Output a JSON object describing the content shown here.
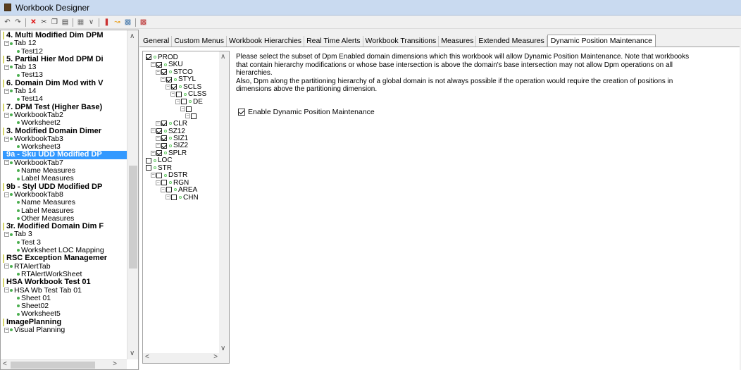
{
  "window": {
    "title": "Workbook Designer"
  },
  "toolbar": {
    "icons": [
      "undo-icon",
      "redo-icon",
      "delete-icon",
      "cut-icon",
      "copy-icon",
      "paste-icon",
      "grid-icon",
      "dropdown-icon",
      "bar-icon",
      "chart-icon",
      "table-icon",
      "graph-icon"
    ]
  },
  "tree": {
    "nodes": [
      {
        "type": "wb",
        "text": "4. Multi Modified Dim DPM"
      },
      {
        "type": "tab",
        "text": "Tab 12"
      },
      {
        "type": "sheet",
        "text": "Test12"
      },
      {
        "type": "wb",
        "text": "5. Partial Hier Mod DPM Di"
      },
      {
        "type": "tab",
        "text": "Tab 13"
      },
      {
        "type": "sheet",
        "text": "Test13"
      },
      {
        "type": "wb",
        "text": "6. Domain Dim Mod with V"
      },
      {
        "type": "tab",
        "text": "Tab 14"
      },
      {
        "type": "sheet",
        "text": "Test14"
      },
      {
        "type": "wb",
        "text": "7. DPM Test (Higher Base)"
      },
      {
        "type": "tab",
        "text": "WorkbookTab2"
      },
      {
        "type": "sheet",
        "text": "Worksheet2"
      },
      {
        "type": "wb",
        "text": "3.  Modified Domain Dimer"
      },
      {
        "type": "tab",
        "text": "WorkbookTab3"
      },
      {
        "type": "sheet",
        "text": "Worksheet3"
      },
      {
        "type": "wb",
        "text": "9a - Sku UDD Modified DP",
        "selected": true
      },
      {
        "type": "tab",
        "text": "WorkbookTab7"
      },
      {
        "type": "sheet",
        "text": "Name Measures"
      },
      {
        "type": "sheet",
        "text": "Label Measures"
      },
      {
        "type": "wb",
        "text": "9b - Styl UDD Modified DP"
      },
      {
        "type": "tab",
        "text": "WorkbookTab8"
      },
      {
        "type": "sheet",
        "text": "Name Measures"
      },
      {
        "type": "sheet",
        "text": "Label Measures"
      },
      {
        "type": "sheet",
        "text": "Other Measures"
      },
      {
        "type": "wb",
        "text": "3r. Modified Domain Dim F"
      },
      {
        "type": "tab",
        "text": "Tab 3"
      },
      {
        "type": "sheet",
        "text": "Test 3"
      },
      {
        "type": "sheet",
        "text": "Worksheet LOC Mapping"
      },
      {
        "type": "wb",
        "text": "RSC Exception Managemer"
      },
      {
        "type": "tab",
        "text": "RTAlertTab"
      },
      {
        "type": "sheet",
        "text": "RTAlertWorkSheet"
      },
      {
        "type": "wb",
        "text": "HSA Workbook Test 01"
      },
      {
        "type": "tab",
        "text": "HSA Wb Test Tab 01"
      },
      {
        "type": "sheet",
        "text": "Sheet 01"
      },
      {
        "type": "sheet",
        "text": "Sheet02"
      },
      {
        "type": "sheet",
        "text": "Worksheet5"
      },
      {
        "type": "wb",
        "text": "ImagePlanning"
      },
      {
        "type": "tab",
        "text": "Visual Planning"
      }
    ]
  },
  "tabs": [
    "General",
    "Custom Menus",
    "Workbook Hierarchies",
    "Real Time Alerts",
    "Workbook Transitions",
    "Measures",
    "Extended Measures",
    "Dynamic Position Maintenance"
  ],
  "active_tab": "Dynamic Position Maintenance",
  "dims": [
    {
      "text": "PROD",
      "checked": true,
      "level": 0
    },
    {
      "text": "SKU",
      "checked": true,
      "level": 1
    },
    {
      "text": "STCO",
      "checked": true,
      "level": 2
    },
    {
      "text": "STYL",
      "checked": true,
      "level": 3
    },
    {
      "text": "SCLS",
      "checked": true,
      "level": 4
    },
    {
      "text": "CLSS",
      "checked": false,
      "level": 5
    },
    {
      "text": "DE",
      "checked": false,
      "level": 6
    },
    {
      "text": "",
      "checked": false,
      "level": 7
    },
    {
      "text": "",
      "checked": false,
      "level": 8
    },
    {
      "text": "CLR",
      "checked": true,
      "level": 2
    },
    {
      "text": "SZ12",
      "checked": true,
      "level": 1
    },
    {
      "text": "SIZ1",
      "checked": true,
      "level": 2
    },
    {
      "text": "SIZ2",
      "checked": true,
      "level": 2
    },
    {
      "text": "SPLR",
      "checked": true,
      "level": 1
    },
    {
      "text": "LOC",
      "checked": false,
      "level": 0
    },
    {
      "text": "STR",
      "checked": false,
      "level": 0
    },
    {
      "text": "DSTR",
      "checked": false,
      "level": 1
    },
    {
      "text": "RGN",
      "checked": false,
      "level": 2
    },
    {
      "text": "AREA",
      "checked": false,
      "level": 3
    },
    {
      "text": "CHN",
      "checked": false,
      "level": 4
    }
  ],
  "description": {
    "line1": "Please select the subset of Dpm Enabled domain dimensions which this workbook will allow Dynamic Position Maintenance. Note that workbooks",
    "line2": "that contain hierarchy modifications or whose base intersection is above the domain's base intersection may not allow Dpm operations on all",
    "line3": "hierarchies.",
    "line4": "Also, Dpm along the partitioning hierarchy of a global domain is not always possible if the operation would require the creation of positions in",
    "line5": "dimensions above the partitioning dimension."
  },
  "enable_label": "Enable Dynamic Position Maintenance",
  "enable_checked": true
}
